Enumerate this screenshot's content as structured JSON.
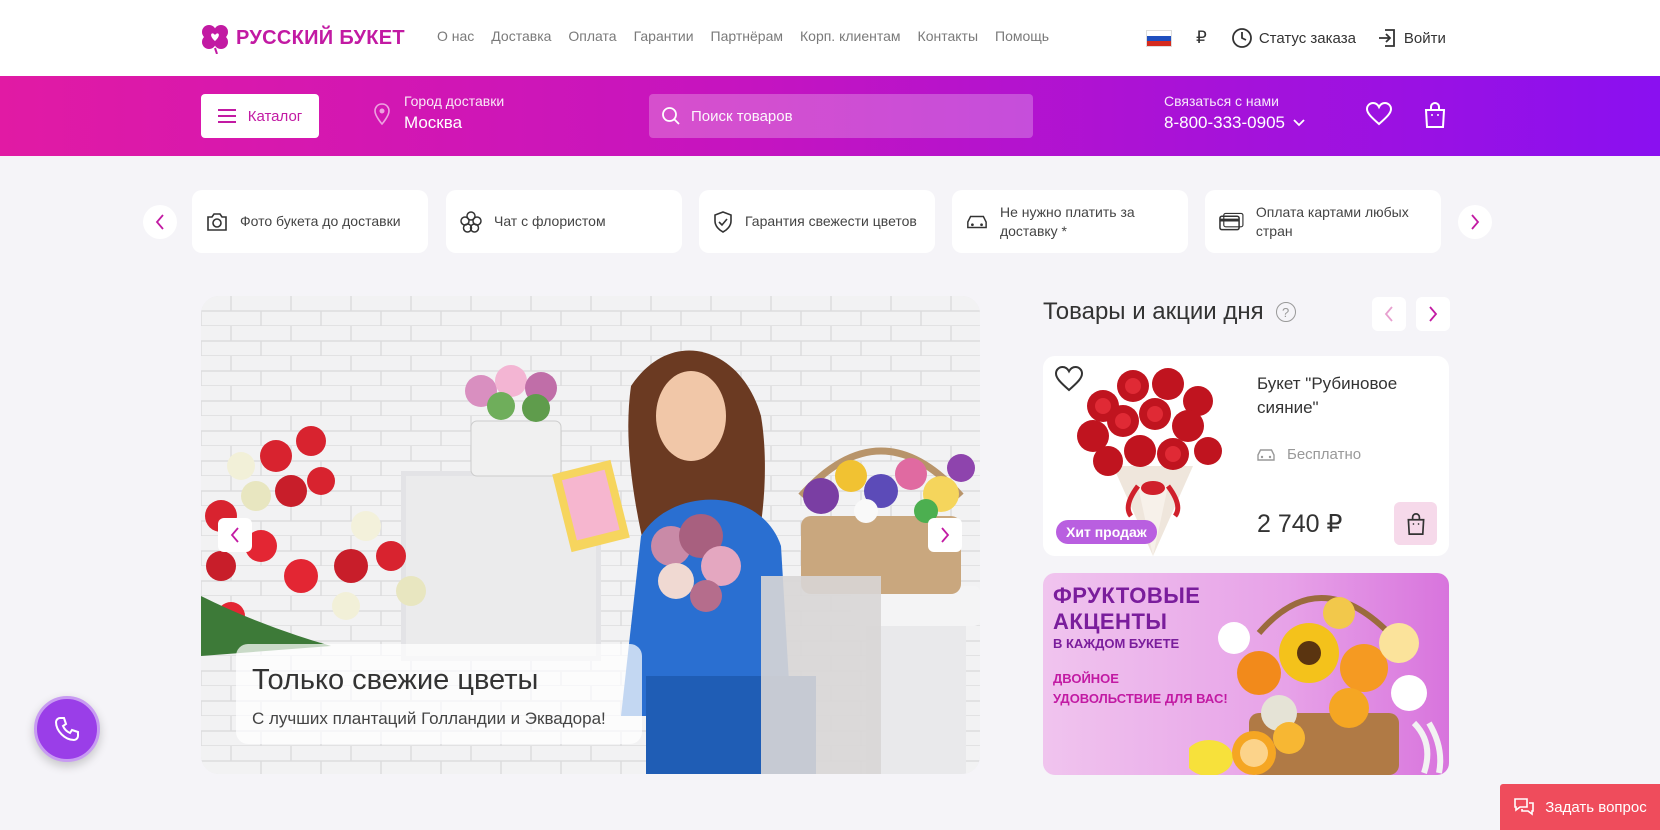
{
  "brand": {
    "name": "РУССКИЙ БУКЕТ",
    "accent": "#c21aa3",
    "gradient_start": "#e11aa4",
    "gradient_end": "#8a10f0"
  },
  "topnav": [
    "О нас",
    "Доставка",
    "Оплата",
    "Гарантии",
    "Партнёрам",
    "Корп. клиентам",
    "Контакты",
    "Помощь"
  ],
  "top_right": {
    "flag": "russia-flag-icon",
    "currency": "₽",
    "order_status": "Статус заказа",
    "login": "Войти"
  },
  "header": {
    "catalog": "Каталог",
    "city_label": "Город доставки",
    "city_value": "Москва",
    "search_placeholder": "Поиск товаров",
    "contact_label": "Связаться с нами",
    "contact_phone": "8-800-333-0905"
  },
  "features": [
    {
      "icon": "camera-icon",
      "text": "Фото букета до доставки"
    },
    {
      "icon": "flower-icon",
      "text": "Чат с флористом"
    },
    {
      "icon": "shield-check-icon",
      "text": "Гарантия свежести цветов"
    },
    {
      "icon": "car-icon",
      "text": "Не нужно платить за доставку *"
    },
    {
      "icon": "card-icon",
      "text": "Оплата картами любых стран"
    }
  ],
  "banner": {
    "title": "Только свежие цветы",
    "subtitle": "С лучших плантаций Голландии и Эквадора!"
  },
  "day_deals": {
    "title": "Товары и акции дня",
    "help": "?",
    "product": {
      "name": "Букет \"Рубиновое сияние\"",
      "shipping": "Бесплатно",
      "price": "2 740 ₽",
      "badge": "Хит продаж"
    },
    "promo": {
      "headline_1": "ФРУКТОВЫЕ",
      "headline_2": "АКЦЕНТЫ",
      "sub": "В КАЖДОМ БУКЕТЕ",
      "detail_1": "ДВОЙНОЕ",
      "detail_2": "УДОВОЛЬСТВИЕ ДЛЯ ВАС!"
    }
  },
  "ask_question": "Задать вопрос"
}
